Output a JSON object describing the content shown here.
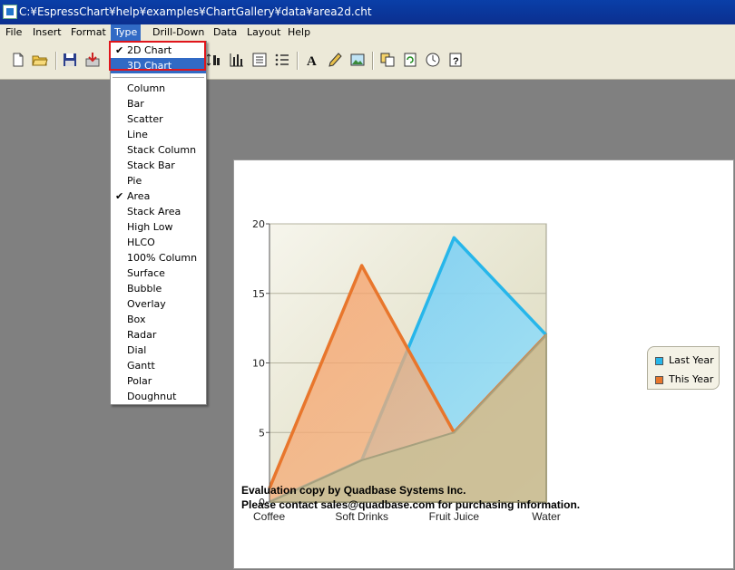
{
  "window": {
    "title": "C:¥EspressChart¥help¥examples¥ChartGallery¥data¥area2d.cht"
  },
  "menubar": [
    "File",
    "Insert",
    "Format",
    "Type",
    "Drill-Down",
    "Data",
    "Layout",
    "Help"
  ],
  "type_menu": {
    "mode_items": [
      {
        "label": "2D Chart",
        "checked": true
      },
      {
        "label": "3D Chart",
        "highlighted": true
      }
    ],
    "chart_items": [
      "Column",
      "Bar",
      "Scatter",
      "Line",
      "Stack Column",
      "Stack Bar",
      "Pie",
      "Area",
      "Stack Area",
      "High Low",
      "HLCO",
      "100% Column",
      "Surface",
      "Bubble",
      "Overlay",
      "Box",
      "Radar",
      "Dial",
      "Gantt",
      "Polar",
      "Doughnut"
    ],
    "checked_chart": "Area"
  },
  "toolbar_icons": [
    "new-file-icon",
    "open-folder-icon",
    "save-icon",
    "export-icon",
    "chart-type-icon",
    "axis-icon",
    "list-icon",
    "numbered-list-icon",
    "text-icon",
    "pen-icon",
    "image-icon",
    "copy-icon",
    "refresh-icon",
    "clock-icon",
    "help-icon"
  ],
  "chart_data": {
    "type": "area",
    "categories": [
      "Coffee",
      "Soft Drinks",
      "Fruit Juice",
      "Water"
    ],
    "series": [
      {
        "name": "Last Year",
        "values": [
          0,
          3,
          19,
          12
        ],
        "color": "#27b6ea"
      },
      {
        "name": "This Year",
        "values": [
          1,
          17,
          5,
          12
        ],
        "color": "#e8762c"
      }
    ],
    "ylim": [
      0,
      20
    ],
    "y_ticks": [
      "0",
      "5",
      "10",
      "15",
      "20"
    ],
    "grid": true,
    "legend_position": "right"
  },
  "watermark": {
    "line1": "Evaluation copy by Quadbase Systems Inc.",
    "line2": "Please contact sales@quadbase.com for purchasing information."
  },
  "colors": {
    "titlebar": "#0a3fa8",
    "menu_highlight": "#316ac5",
    "selection_box": "#e0151b",
    "plot_bg": "#e6e4ce"
  }
}
